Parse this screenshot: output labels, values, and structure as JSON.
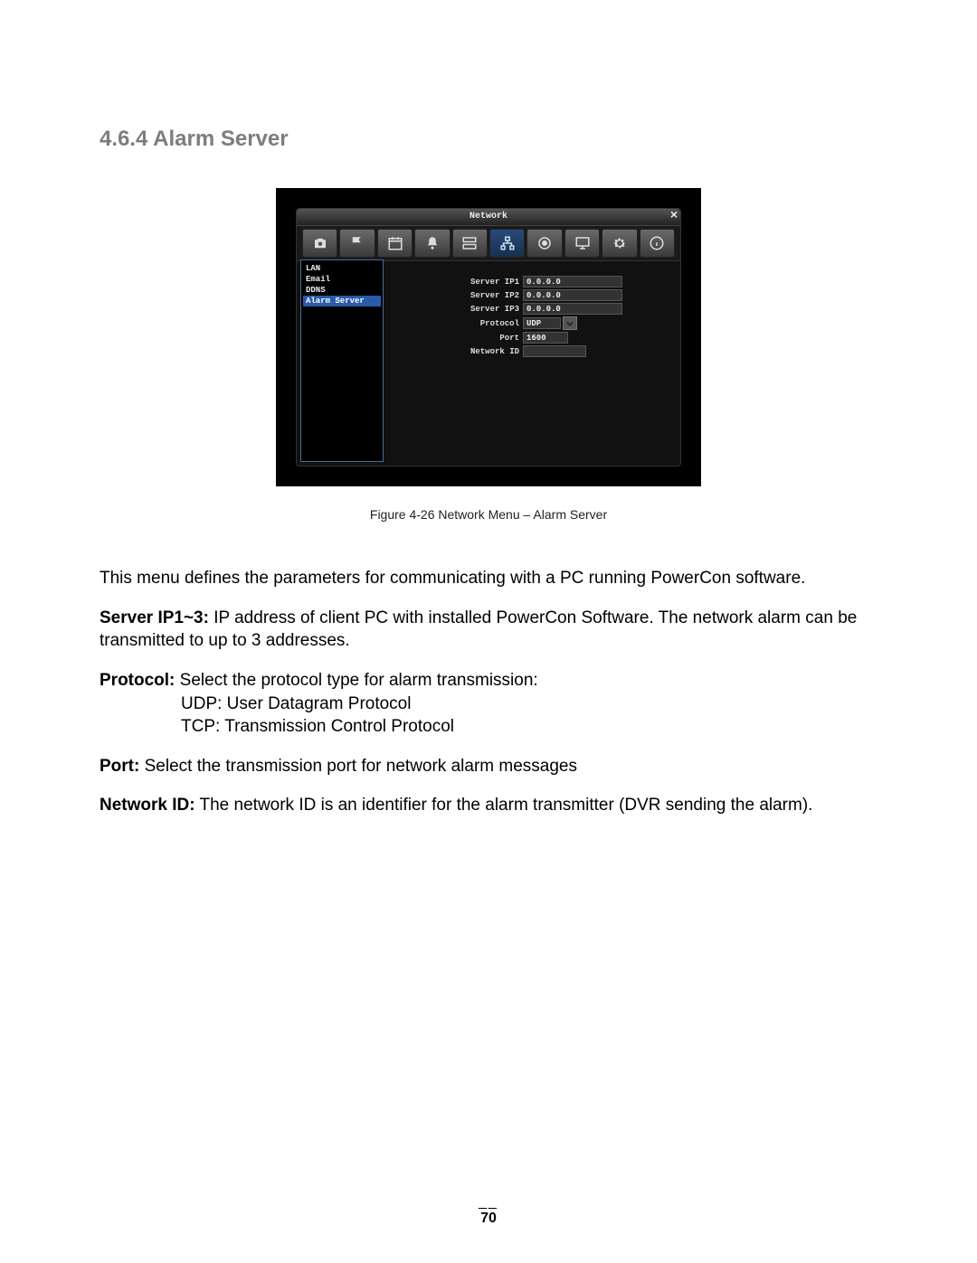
{
  "heading": "4.6.4   Alarm Server",
  "screenshot": {
    "title": "Network",
    "toolbar_icons": [
      "camera-icon",
      "flag-icon",
      "calendar-icon",
      "bell-icon",
      "storage-icon",
      "network-icon",
      "target-icon",
      "monitor-icon",
      "gear-icon",
      "info-icon"
    ],
    "active_toolbar_index": 5,
    "sidebar": [
      {
        "label": "LAN",
        "selected": false
      },
      {
        "label": "Email",
        "selected": false
      },
      {
        "label": "DDNS",
        "selected": false
      },
      {
        "label": "Alarm Server",
        "selected": true
      }
    ],
    "fields": [
      {
        "label": "Server IP1",
        "value": "0.0.0.0",
        "type": "text",
        "width": "normal"
      },
      {
        "label": "Server IP2",
        "value": "0.0.0.0",
        "type": "text",
        "width": "normal"
      },
      {
        "label": "Server IP3",
        "value": "0.0.0.0",
        "type": "text",
        "width": "normal"
      },
      {
        "label": "Protocol",
        "value": "UDP",
        "type": "select",
        "width": "short"
      },
      {
        "label": "Port",
        "value": "1600",
        "type": "text",
        "width": "short"
      },
      {
        "label": "Network ID",
        "value": "",
        "type": "text",
        "width": "med"
      }
    ]
  },
  "caption": "Figure 4-26  Network Menu – Alarm Server",
  "paragraphs": {
    "intro": "This menu defines the parameters for communicating with a PC running PowerCon software.",
    "server_ip_label": "Server IP1~3:",
    "server_ip_text": " IP address of client PC with installed PowerCon Software. The network alarm can be transmitted to up to 3 addresses.",
    "protocol_label": "Protocol:",
    "protocol_text": " Select the protocol type for alarm transmission:",
    "protocol_udp": "UDP: User Datagram Protocol",
    "protocol_tcp": "TCP: Transmission Control Protocol",
    "port_label": "Port:",
    "port_text": " Select the transmission port for network alarm messages",
    "netid_label": "Network ID:",
    "netid_text": " The network ID is an identifier for the alarm transmitter (DVR sending the alarm)."
  },
  "footer": {
    "dash": "__",
    "page": "70"
  }
}
